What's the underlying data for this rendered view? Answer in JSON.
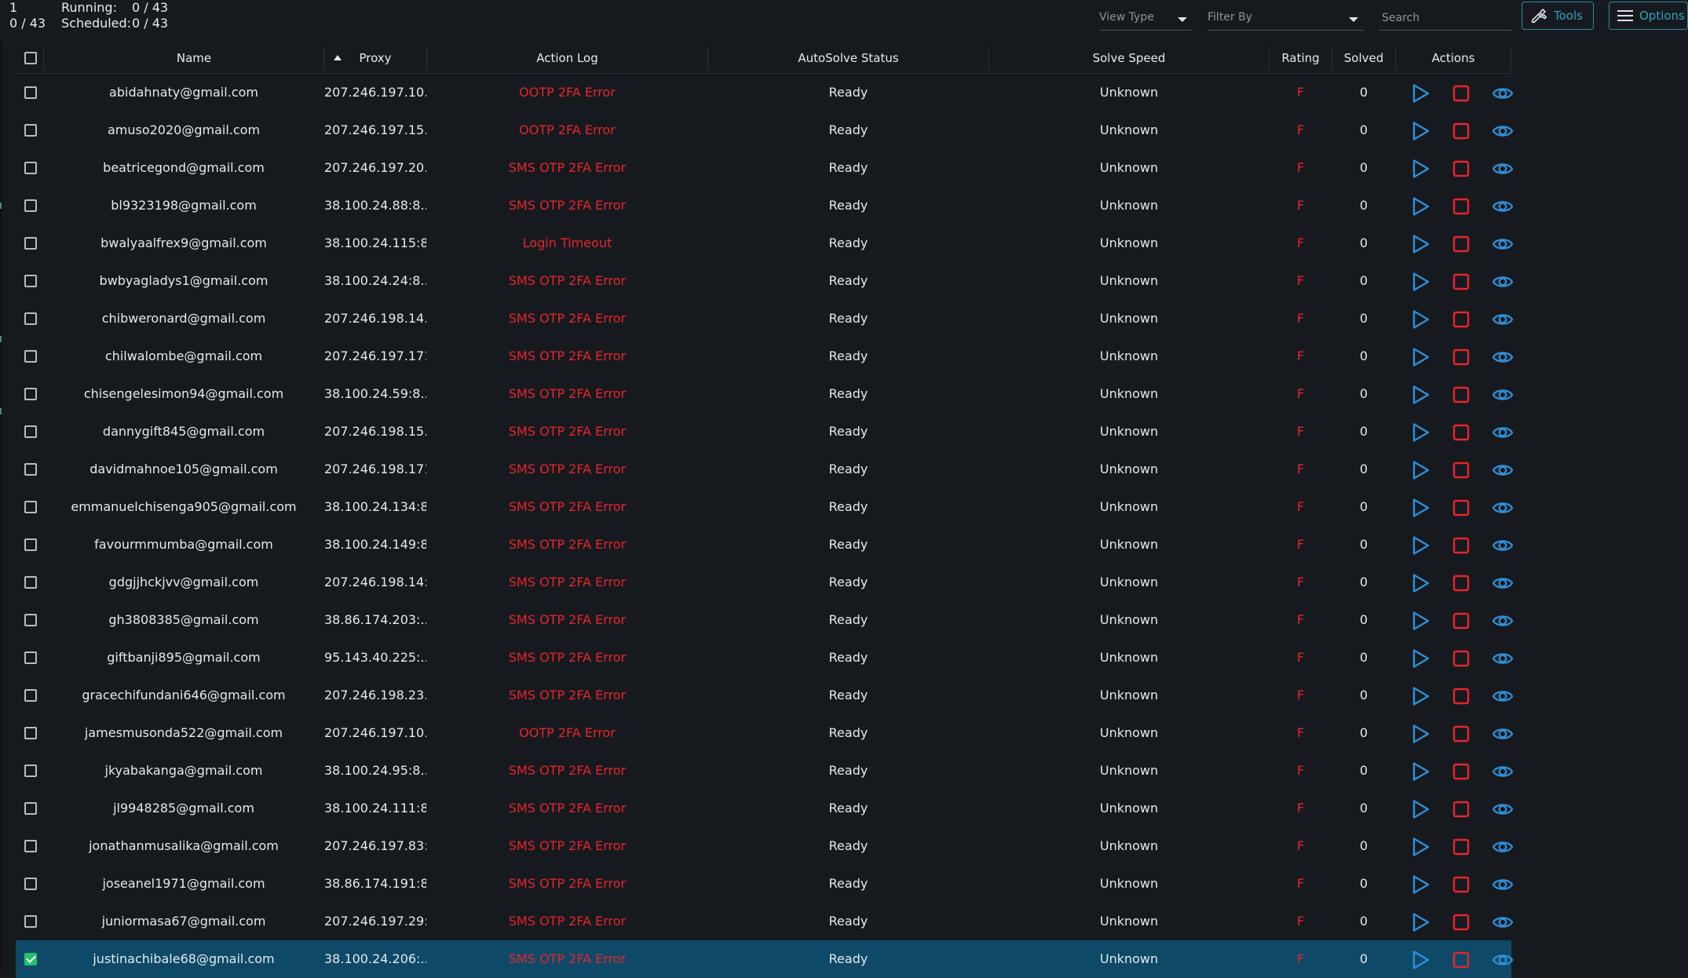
{
  "stats": {
    "top_left_count": "1",
    "top_left_fraction": "0 / 43",
    "running_label": "Running:",
    "running_value": "0 / 43",
    "scheduled_label": "Scheduled:",
    "scheduled_value": "0 / 43"
  },
  "toolbar": {
    "view_type_placeholder": "View Type",
    "filter_by_placeholder": "Filter By",
    "search_placeholder": "Search",
    "tools_label": "Tools",
    "options_label": "Options"
  },
  "table": {
    "columns": {
      "name": "Name",
      "proxy": "Proxy",
      "action_log": "Action Log",
      "autosolve_status": "AutoSolve Status",
      "solve_speed": "Solve Speed",
      "rating": "Rating",
      "solved": "Solved",
      "actions": "Actions"
    },
    "sort_column": "name",
    "sort_direction": "ascending",
    "rows": [
      {
        "name": "abidahnaty@gmail.com",
        "proxy": "207.246.197.10...",
        "log": "OOTP 2FA Error",
        "status": "Ready",
        "speed": "Unknown",
        "rating": "F",
        "solved": "0",
        "checked": false
      },
      {
        "name": "amuso2020@gmail.com",
        "proxy": "207.246.197.15...",
        "log": "OOTP 2FA Error",
        "status": "Ready",
        "speed": "Unknown",
        "rating": "F",
        "solved": "0",
        "checked": false
      },
      {
        "name": "beatricegond@gmail.com",
        "proxy": "207.246.197.20...",
        "log": "SMS OTP 2FA Error",
        "status": "Ready",
        "speed": "Unknown",
        "rating": "F",
        "solved": "0",
        "checked": false
      },
      {
        "name": "bl9323198@gmail.com",
        "proxy": "38.100.24.88:8...",
        "log": "SMS OTP 2FA Error",
        "status": "Ready",
        "speed": "Unknown",
        "rating": "F",
        "solved": "0",
        "checked": false
      },
      {
        "name": "bwalyaalfrex9@gmail.com",
        "proxy": "38.100.24.115:8...",
        "log": "Login Timeout",
        "status": "Ready",
        "speed": "Unknown",
        "rating": "F",
        "solved": "0",
        "checked": false
      },
      {
        "name": "bwbyagladys1@gmail.com",
        "proxy": "38.100.24.24:8...",
        "log": "SMS OTP 2FA Error",
        "status": "Ready",
        "speed": "Unknown",
        "rating": "F",
        "solved": "0",
        "checked": false
      },
      {
        "name": "chibweronard@gmail.com",
        "proxy": "207.246.198.14...",
        "log": "SMS OTP 2FA Error",
        "status": "Ready",
        "speed": "Unknown",
        "rating": "F",
        "solved": "0",
        "checked": false
      },
      {
        "name": "chilwalombe@gmail.com",
        "proxy": "207.246.197.171...",
        "log": "SMS OTP 2FA Error",
        "status": "Ready",
        "speed": "Unknown",
        "rating": "F",
        "solved": "0",
        "checked": false
      },
      {
        "name": "chisengelesimon94@gmail.com",
        "proxy": "38.100.24.59:8...",
        "log": "SMS OTP 2FA Error",
        "status": "Ready",
        "speed": "Unknown",
        "rating": "F",
        "solved": "0",
        "checked": false
      },
      {
        "name": "dannygift845@gmail.com",
        "proxy": "207.246.198.15...",
        "log": "SMS OTP 2FA Error",
        "status": "Ready",
        "speed": "Unknown",
        "rating": "F",
        "solved": "0",
        "checked": false
      },
      {
        "name": "davidmahnoe105@gmail.com",
        "proxy": "207.246.198.171...",
        "log": "SMS OTP 2FA Error",
        "status": "Ready",
        "speed": "Unknown",
        "rating": "F",
        "solved": "0",
        "checked": false
      },
      {
        "name": "emmanuelchisenga905@gmail.com",
        "proxy": "38.100.24.134:8...",
        "log": "SMS OTP 2FA Error",
        "status": "Ready",
        "speed": "Unknown",
        "rating": "F",
        "solved": "0",
        "checked": false
      },
      {
        "name": "favourmmumba@gmail.com",
        "proxy": "38.100.24.149:8...",
        "log": "SMS OTP 2FA Error",
        "status": "Ready",
        "speed": "Unknown",
        "rating": "F",
        "solved": "0",
        "checked": false
      },
      {
        "name": "gdgjjhckjvv@gmail.com",
        "proxy": "207.246.198.14:...",
        "log": "SMS OTP 2FA Error",
        "status": "Ready",
        "speed": "Unknown",
        "rating": "F",
        "solved": "0",
        "checked": false
      },
      {
        "name": "gh3808385@gmail.com",
        "proxy": "38.86.174.203:...",
        "log": "SMS OTP 2FA Error",
        "status": "Ready",
        "speed": "Unknown",
        "rating": "F",
        "solved": "0",
        "checked": false
      },
      {
        "name": "giftbanji895@gmail.com",
        "proxy": "95.143.40.225:...",
        "log": "SMS OTP 2FA Error",
        "status": "Ready",
        "speed": "Unknown",
        "rating": "F",
        "solved": "0",
        "checked": false
      },
      {
        "name": "gracechifundani646@gmail.com",
        "proxy": "207.246.198.23...",
        "log": "SMS OTP 2FA Error",
        "status": "Ready",
        "speed": "Unknown",
        "rating": "F",
        "solved": "0",
        "checked": false
      },
      {
        "name": "jamesmusonda522@gmail.com",
        "proxy": "207.246.197.10...",
        "log": "OOTP 2FA Error",
        "status": "Ready",
        "speed": "Unknown",
        "rating": "F",
        "solved": "0",
        "checked": false
      },
      {
        "name": "jkyabakanga@gmail.com",
        "proxy": "38.100.24.95:8...",
        "log": "SMS OTP 2FA Error",
        "status": "Ready",
        "speed": "Unknown",
        "rating": "F",
        "solved": "0",
        "checked": false
      },
      {
        "name": "jl9948285@gmail.com",
        "proxy": "38.100.24.111:8...",
        "log": "SMS OTP 2FA Error",
        "status": "Ready",
        "speed": "Unknown",
        "rating": "F",
        "solved": "0",
        "checked": false
      },
      {
        "name": "jonathanmusalika@gmail.com",
        "proxy": "207.246.197.83:...",
        "log": "SMS OTP 2FA Error",
        "status": "Ready",
        "speed": "Unknown",
        "rating": "F",
        "solved": "0",
        "checked": false
      },
      {
        "name": "joseanel1971@gmail.com",
        "proxy": "38.86.174.191:8...",
        "log": "SMS OTP 2FA Error",
        "status": "Ready",
        "speed": "Unknown",
        "rating": "F",
        "solved": "0",
        "checked": false
      },
      {
        "name": "juniormasa67@gmail.com",
        "proxy": "207.246.197.29:...",
        "log": "SMS OTP 2FA Error",
        "status": "Ready",
        "speed": "Unknown",
        "rating": "F",
        "solved": "0",
        "checked": false
      },
      {
        "name": "justinachibale68@gmail.com",
        "proxy": "38.100.24.206:...",
        "log": "SMS OTP 2FA Error",
        "status": "Ready",
        "speed": "Unknown",
        "rating": "F",
        "solved": "0",
        "checked": true
      }
    ]
  },
  "icons": {
    "play": "play-icon",
    "stop": "stop-icon",
    "view": "eye-icon",
    "tools": "wrench-icon",
    "options": "hamburger-menu-icon"
  },
  "colors": {
    "background": "#161a1f",
    "error": "#e8242b",
    "accent": "#2fa3bf",
    "play": "#2f8fd8",
    "stop": "#e8242b",
    "selected_row": "#0e4a68",
    "checked": "#25c06a"
  }
}
